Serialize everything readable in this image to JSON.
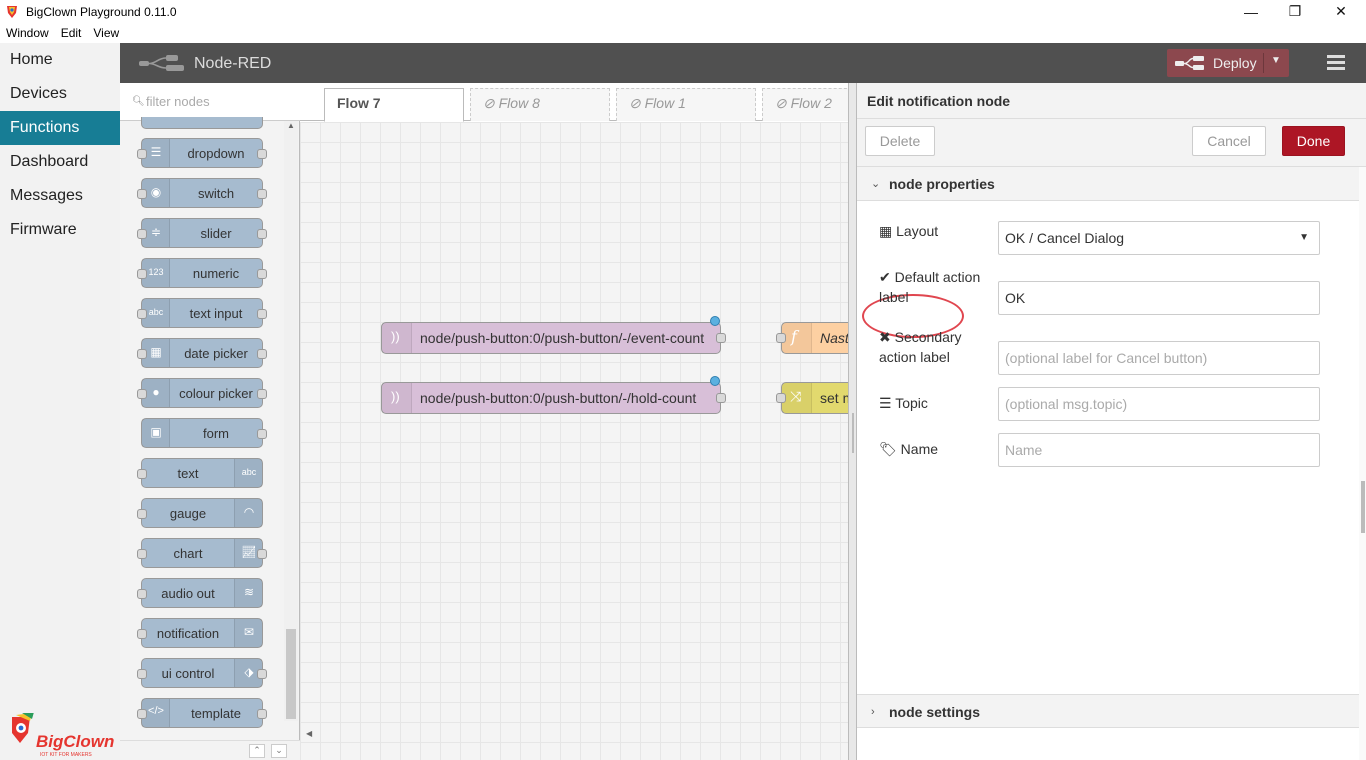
{
  "window": {
    "title": "BigClown Playground 0.11.0",
    "controls": {
      "minimize": "—",
      "maximize": "❐",
      "close": "✕"
    },
    "menu": [
      "Window",
      "Edit",
      "View"
    ]
  },
  "sidebar": {
    "items": [
      {
        "label": "Home",
        "active": false
      },
      {
        "label": "Devices",
        "active": false
      },
      {
        "label": "Functions",
        "active": true
      },
      {
        "label": "Dashboard",
        "active": false
      },
      {
        "label": "Messages",
        "active": false
      },
      {
        "label": "Firmware",
        "active": false
      }
    ],
    "logo_text": "BigClown",
    "logo_tagline": "IOT KIT FOR MAKERS",
    "accent": "#177d95"
  },
  "header": {
    "title": "Node-RED",
    "deploy_label": "Deploy"
  },
  "palette": {
    "filter_placeholder": "filter nodes",
    "nodes": [
      {
        "label": "dropdown",
        "icon": "list-icon",
        "icon_side": "left"
      },
      {
        "label": "switch",
        "icon": "toggle-icon",
        "icon_side": "left"
      },
      {
        "label": "slider",
        "icon": "sliders-icon",
        "icon_side": "left"
      },
      {
        "label": "numeric",
        "icon": "123-icon",
        "icon_side": "left"
      },
      {
        "label": "text input",
        "icon": "abc-icon",
        "icon_side": "left"
      },
      {
        "label": "date picker",
        "icon": "calendar-icon",
        "icon_side": "left"
      },
      {
        "label": "colour picker",
        "icon": "palette-icon",
        "icon_side": "left"
      },
      {
        "label": "form",
        "icon": "form-icon",
        "icon_side": "left"
      },
      {
        "label": "text",
        "icon": "abc-icon",
        "icon_side": "right"
      },
      {
        "label": "gauge",
        "icon": "gauge-icon",
        "icon_side": "right"
      },
      {
        "label": "chart",
        "icon": "chart-icon",
        "icon_side": "right"
      },
      {
        "label": "audio out",
        "icon": "audio-icon",
        "icon_side": "right"
      },
      {
        "label": "notification",
        "icon": "envelope-icon",
        "icon_side": "right"
      },
      {
        "label": "ui control",
        "icon": "control-icon",
        "icon_side": "right"
      },
      {
        "label": "template",
        "icon": "code-icon",
        "icon_side": "left"
      }
    ]
  },
  "workspace": {
    "tabs": [
      {
        "label": "Flow 7",
        "active": true
      },
      {
        "label": "Flow 8",
        "active": false,
        "disabled": true
      },
      {
        "label": "Flow 1",
        "active": false,
        "disabled": true
      },
      {
        "label": "Flow 2",
        "active": false,
        "disabled": true
      }
    ],
    "disabled_glyph": "⊘",
    "nodes": [
      {
        "label": "node/push-button:0/push-button/-/event-count"
      },
      {
        "label": "node/push-button:0/push-button/-/hold-count"
      },
      {
        "label": "Nast"
      },
      {
        "label": "set m"
      }
    ]
  },
  "tray": {
    "title": "Edit notification node",
    "delete_label": "Delete",
    "cancel_label": "Cancel",
    "done_label": "Done",
    "section_properties": "node properties",
    "section_settings": "node settings",
    "fields": {
      "layout_label": "Layout",
      "layout_value": "OK / Cancel Dialog",
      "default_label": "Default action label",
      "default_value": "OK",
      "secondary_label": "Secondary action label",
      "secondary_placeholder": "(optional label for Cancel button)",
      "topic_label": "Topic",
      "topic_placeholder": "(optional msg.topic)",
      "name_label": "Name",
      "name_placeholder": "Name"
    }
  }
}
